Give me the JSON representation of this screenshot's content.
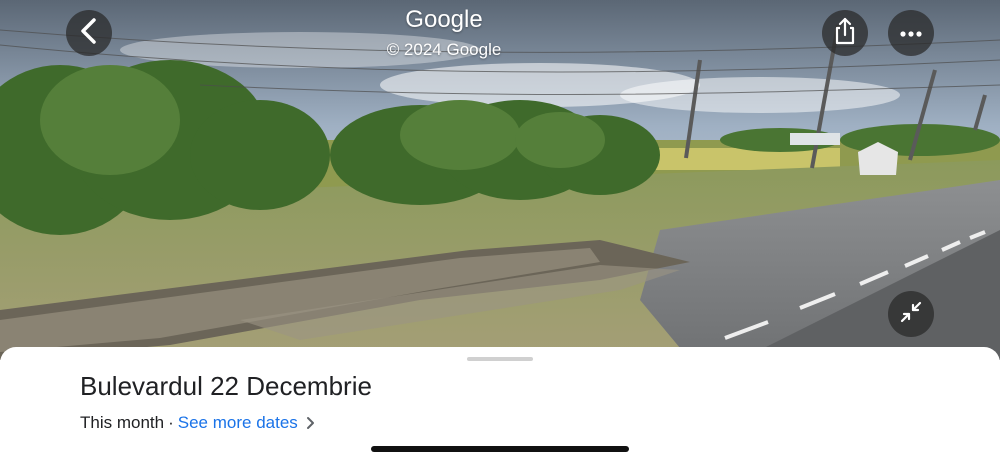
{
  "header": {
    "title": "Google",
    "copyright": "© 2024 Google"
  },
  "controls": {
    "back": "back-arrow-icon",
    "share": "share-icon",
    "more": "more-horizontal-icon",
    "collapse": "collapse-arrows-icon"
  },
  "sheet": {
    "title": "Bulevardul 22 Decembrie",
    "date_label": "This month",
    "separator": "·",
    "more_dates_link": "See more dates"
  },
  "colors": {
    "link": "#1a73e8",
    "button_bg": "#2a2a2a"
  }
}
